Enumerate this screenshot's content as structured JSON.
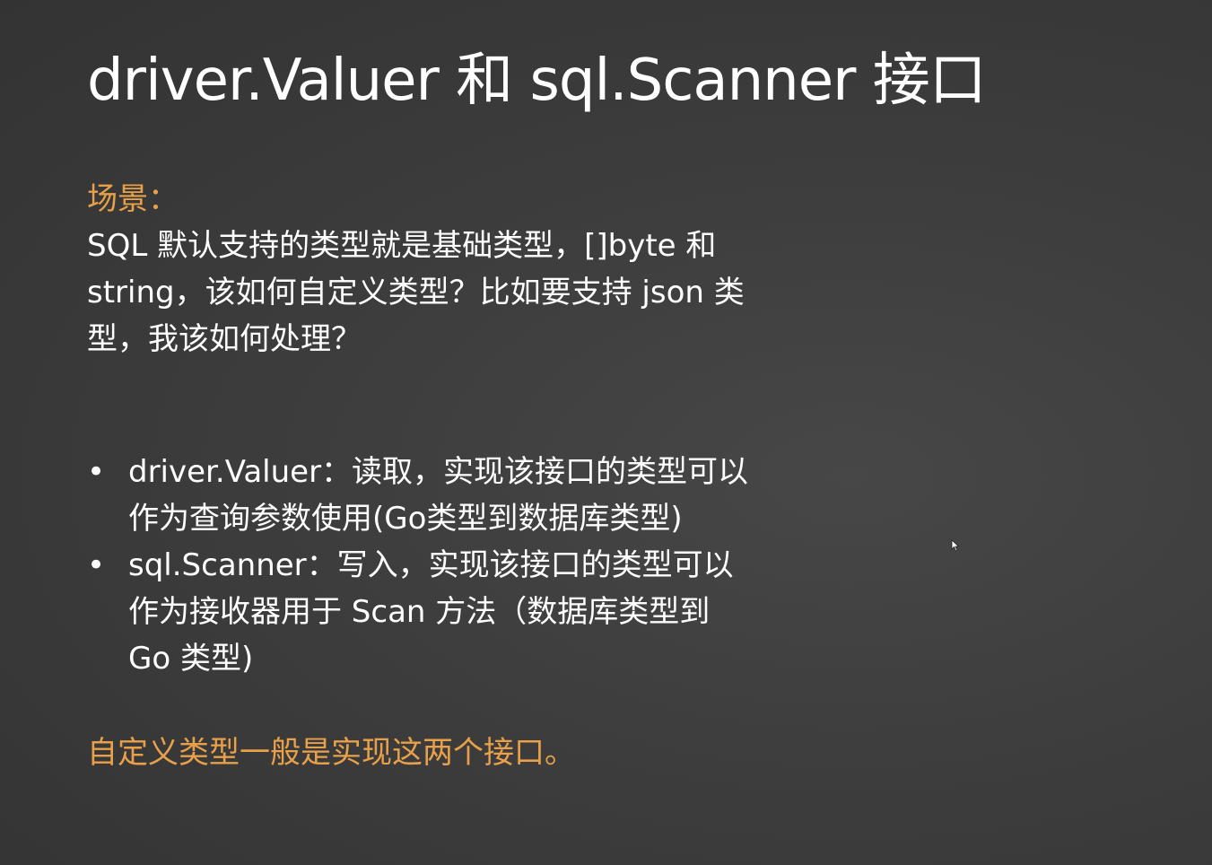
{
  "slide": {
    "title": "driver.Valuer 和 sql.Scanner 接口",
    "scene_label": "场景：",
    "scene_lines": [
      "SQL 默认支持的类型就是基础类型，[]byte 和",
      "string，该如何自定义类型？比如要支持 json 类",
      "型，我该如何处理？"
    ],
    "bullets": [
      {
        "marker": "•",
        "lines": [
          "driver.Valuer：读取，实现该接口的类型可以",
          "作为查询参数使用(Go类型到数据库类型)"
        ]
      },
      {
        "marker": "•",
        "lines": [
          "sql.Scanner：写入，实现该接口的类型可以",
          "作为接收器用于 Scan 方法（数据库类型到",
          "Go 类型)"
        ]
      }
    ],
    "summary": "自定义类型一般是实现这两个接口。"
  },
  "colors": {
    "accent": "#e8a04a",
    "text": "#ffffff",
    "background": "#3d3d3d"
  },
  "icons": {
    "cursor": "mouse-pointer-icon"
  }
}
